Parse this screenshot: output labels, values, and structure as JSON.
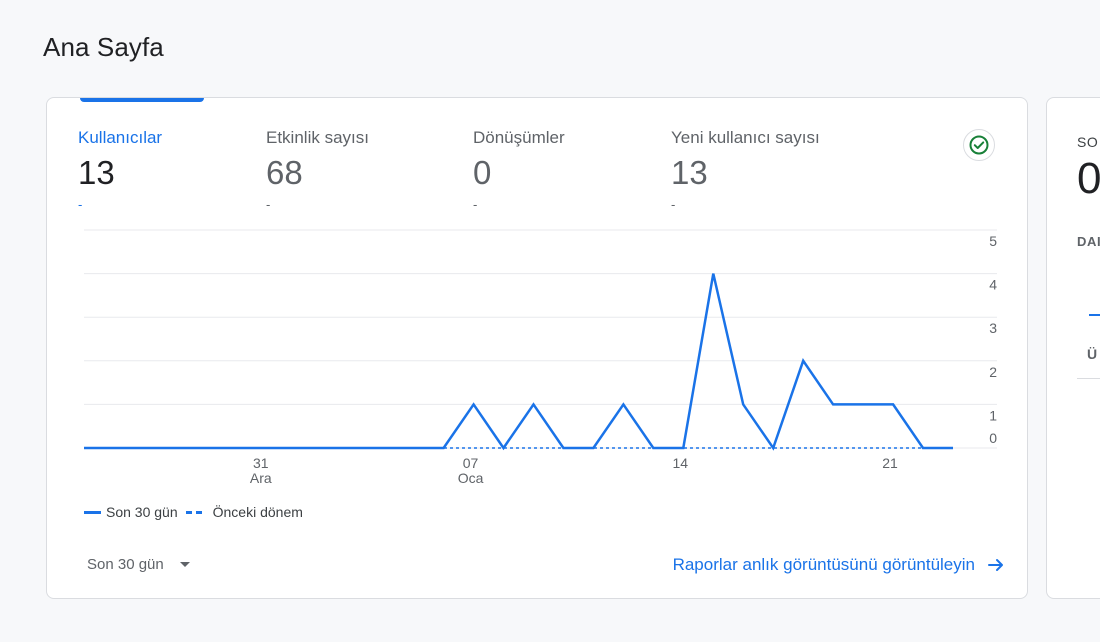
{
  "page": {
    "title": "Ana Sayfa"
  },
  "metrics": [
    {
      "label": "Kullanıcılar",
      "value": "13",
      "delta": "-"
    },
    {
      "label": "Etkinlik sayısı",
      "value": "68",
      "delta": "-"
    },
    {
      "label": "Dönüşümler",
      "value": "0",
      "delta": "-"
    },
    {
      "label": "Yeni kullanıcı sayısı",
      "value": "13",
      "delta": "-"
    }
  ],
  "status_icon": "check-circle-icon",
  "colors": {
    "accent": "#1a73e8",
    "success": "#188038"
  },
  "chart_data": {
    "type": "line",
    "x_tick_labels": [
      {
        "day": "31",
        "month": "Ara"
      },
      {
        "day": "07",
        "month": "Oca"
      },
      {
        "day": "14",
        "month": ""
      },
      {
        "day": "21",
        "month": ""
      }
    ],
    "y_ticks": [
      "5",
      "4",
      "3",
      "2",
      "1",
      "0"
    ],
    "ylim": [
      0,
      5
    ],
    "series": [
      {
        "name": "Son 30 gün",
        "style": "solid",
        "values": [
          0,
          0,
          0,
          0,
          0,
          0,
          0,
          0,
          0,
          0,
          0,
          0,
          0,
          1,
          0,
          1,
          0,
          0,
          1,
          0,
          0,
          4,
          1,
          0,
          2,
          1,
          1,
          1,
          0,
          0
        ]
      },
      {
        "name": "Önceki dönem",
        "style": "dashed",
        "values": [
          0,
          0,
          0,
          0,
          0,
          0,
          0,
          0,
          0,
          0,
          0,
          0,
          0,
          0,
          0,
          0,
          0,
          0,
          0,
          0,
          0,
          0,
          0,
          0,
          0,
          0,
          0,
          0,
          0,
          0
        ]
      }
    ],
    "grid": true,
    "legend_position": "bottom-left"
  },
  "legend": {
    "current": "Son 30 gün",
    "previous": "Önceki dönem"
  },
  "period_select": {
    "value": "Son 30 gün"
  },
  "report_link": {
    "label": "Raporlar anlık görüntüsünü görüntüleyin"
  },
  "right_card": {
    "label1": "SO",
    "value": "0",
    "label2": "DAI",
    "label3": "Ü"
  }
}
